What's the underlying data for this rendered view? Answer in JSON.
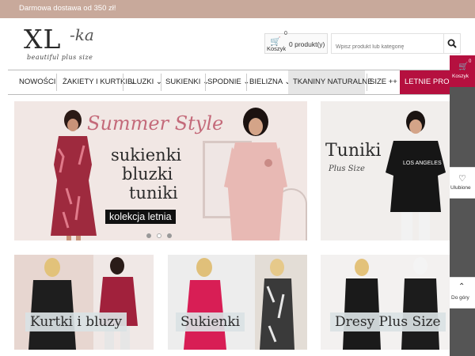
{
  "topbar": {
    "text": "Darmowa dostawa od 350 zł!"
  },
  "logo": {
    "main": "XL",
    "suffix": "-ka",
    "tagline": "beautiful plus size"
  },
  "cart": {
    "count": "0",
    "label": "Koszyk",
    "products": "0 produkt(y)"
  },
  "search": {
    "placeholder": "Wpisz produkt lub kategorię"
  },
  "nav": {
    "items": [
      {
        "label": "NOWOŚCI"
      },
      {
        "label": "ŻAKIETY I KURTKI ⌄"
      },
      {
        "label": "BLUZKI ⌄"
      },
      {
        "label": "SUKIENKI ⌄"
      },
      {
        "label": "SPODNIE ⌄"
      },
      {
        "label": "BIELIZNA ⌄"
      },
      {
        "label": "TKANINY NATURALNE"
      },
      {
        "label": "SIZE ++ ⌄"
      },
      {
        "label": "LETNIE PROMO"
      }
    ]
  },
  "sidebar": {
    "cart_label": "Koszyk",
    "cart_count": "0",
    "favorites_label": "Ulubione",
    "top_label": "Do góry"
  },
  "banner": {
    "script": "Summer Style",
    "line1": "sukienki",
    "line2": "bluzki",
    "line3": "tuniki",
    "badge": "kolekcja letnia",
    "slides": 3,
    "active_slide": 2
  },
  "promo_tuniki": {
    "title": "Tuniki",
    "subtitle": "Plus Size"
  },
  "categories": [
    {
      "label": "Kurtki i bluzy"
    },
    {
      "label": "Sukienki"
    },
    {
      "label": "Dresy Plus Size"
    }
  ],
  "colors": {
    "topbar": "#c8a99b",
    "accent": "#b5103f",
    "sidebar": "#555555"
  }
}
